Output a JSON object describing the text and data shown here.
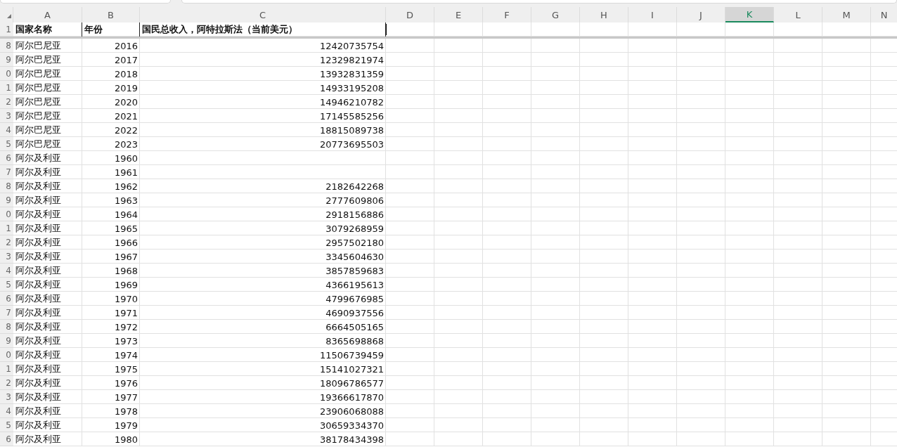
{
  "column_headers": [
    {
      "label": "A",
      "selected": false
    },
    {
      "label": "B",
      "selected": false
    },
    {
      "label": "C",
      "selected": false
    },
    {
      "label": "D",
      "selected": false
    },
    {
      "label": "E",
      "selected": false
    },
    {
      "label": "F",
      "selected": false
    },
    {
      "label": "G",
      "selected": false
    },
    {
      "label": "H",
      "selected": false
    },
    {
      "label": "I",
      "selected": false
    },
    {
      "label": "J",
      "selected": false
    },
    {
      "label": "K",
      "selected": true
    },
    {
      "label": "L",
      "selected": false
    },
    {
      "label": "M",
      "selected": false
    },
    {
      "label": "N",
      "selected": false
    }
  ],
  "header_row": {
    "row_number": "1",
    "cells": [
      "国家名称",
      "年份",
      "国民总收入，阿特拉斯法（当前美元）"
    ]
  },
  "rows": [
    {
      "row_number": "8",
      "country": "阿尔巴尼亚",
      "year": "2016",
      "value": "12420735754"
    },
    {
      "row_number": "9",
      "country": "阿尔巴尼亚",
      "year": "2017",
      "value": "12329821974"
    },
    {
      "row_number": "0",
      "country": "阿尔巴尼亚",
      "year": "2018",
      "value": "13932831359"
    },
    {
      "row_number": "1",
      "country": "阿尔巴尼亚",
      "year": "2019",
      "value": "14933195208"
    },
    {
      "row_number": "2",
      "country": "阿尔巴尼亚",
      "year": "2020",
      "value": "14946210782"
    },
    {
      "row_number": "3",
      "country": "阿尔巴尼亚",
      "year": "2021",
      "value": "17145585256"
    },
    {
      "row_number": "4",
      "country": "阿尔巴尼亚",
      "year": "2022",
      "value": "18815089738"
    },
    {
      "row_number": "5",
      "country": "阿尔巴尼亚",
      "year": "2023",
      "value": "20773695503"
    },
    {
      "row_number": "6",
      "country": "阿尔及利亚",
      "year": "1960"
    },
    {
      "row_number": "7",
      "country": "阿尔及利亚",
      "year": "1961"
    },
    {
      "row_number": "8",
      "country": "阿尔及利亚",
      "year": "1962",
      "value": "2182642268"
    },
    {
      "row_number": "9",
      "country": "阿尔及利亚",
      "year": "1963",
      "value": "2777609806"
    },
    {
      "row_number": "0",
      "country": "阿尔及利亚",
      "year": "1964",
      "value": "2918156886"
    },
    {
      "row_number": "1",
      "country": "阿尔及利亚",
      "year": "1965",
      "value": "3079268959"
    },
    {
      "row_number": "2",
      "country": "阿尔及利亚",
      "year": "1966",
      "value": "2957502180"
    },
    {
      "row_number": "3",
      "country": "阿尔及利亚",
      "year": "1967",
      "value": "3345604630"
    },
    {
      "row_number": "4",
      "country": "阿尔及利亚",
      "year": "1968",
      "value": "3857859683"
    },
    {
      "row_number": "5",
      "country": "阿尔及利亚",
      "year": "1969",
      "value": "4366195613"
    },
    {
      "row_number": "6",
      "country": "阿尔及利亚",
      "year": "1970",
      "value": "4799676985"
    },
    {
      "row_number": "7",
      "country": "阿尔及利亚",
      "year": "1971",
      "value": "4690937556"
    },
    {
      "row_number": "8",
      "country": "阿尔及利亚",
      "year": "1972",
      "value": "6664505165"
    },
    {
      "row_number": "9",
      "country": "阿尔及利亚",
      "year": "1973",
      "value": "8365698868"
    },
    {
      "row_number": "0",
      "country": "阿尔及利亚",
      "year": "1974",
      "value": "11506739459"
    },
    {
      "row_number": "1",
      "country": "阿尔及利亚",
      "year": "1975",
      "value": "15141027321"
    },
    {
      "row_number": "2",
      "country": "阿尔及利亚",
      "year": "1976",
      "value": "18096786577"
    },
    {
      "row_number": "3",
      "country": "阿尔及利亚",
      "year": "1977",
      "value": "19366617870"
    },
    {
      "row_number": "4",
      "country": "阿尔及利亚",
      "year": "1978",
      "value": "23906068088"
    },
    {
      "row_number": "5",
      "country": "阿尔及利亚",
      "year": "1979",
      "value": "30659334370"
    },
    {
      "row_number": "6",
      "country": "阿尔及利亚",
      "year": "1980",
      "value": "38178434398"
    }
  ]
}
